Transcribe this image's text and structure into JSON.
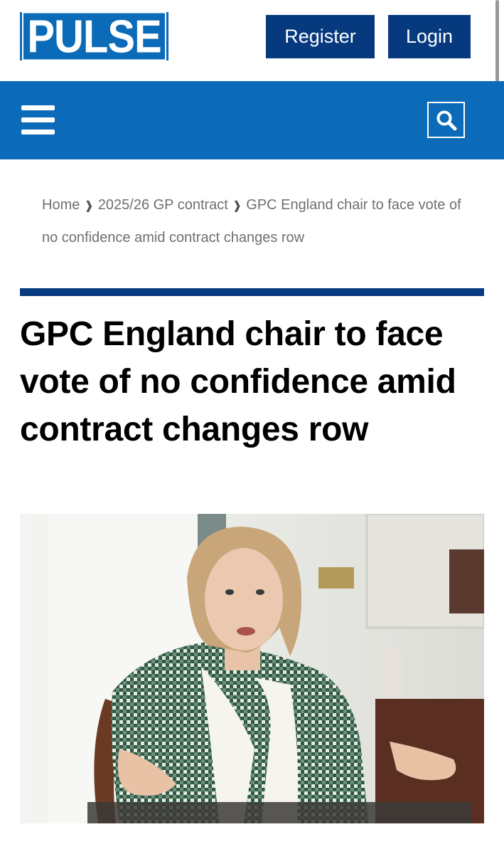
{
  "header": {
    "logo_text": "PULSE",
    "register_label": "Register",
    "login_label": "Login"
  },
  "nav": {
    "menu_icon": "hamburger-menu-icon",
    "search_icon": "search-icon"
  },
  "breadcrumb": {
    "items": [
      "Home",
      "2025/26 GP contract",
      "GPC England chair to face vote of no confidence amid contract changes row"
    ],
    "separator": "❱"
  },
  "article": {
    "title": "GPC England chair to face vote of no confidence amid contract changes row"
  },
  "colors": {
    "brand_blue": "#0b6bb8",
    "navy": "#06397e",
    "breadcrumb_text": "#6f6f6f"
  }
}
